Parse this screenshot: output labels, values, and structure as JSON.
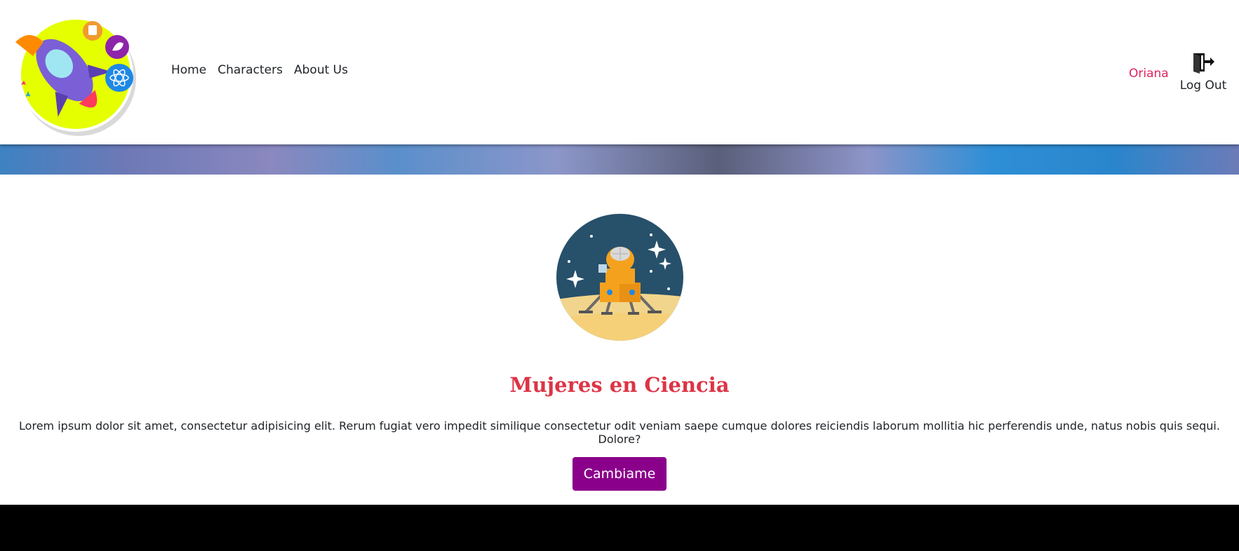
{
  "nav": {
    "items": [
      {
        "label": "Home"
      },
      {
        "label": "Characters"
      },
      {
        "label": "About Us"
      }
    ]
  },
  "user": {
    "name": "Oriana",
    "logout_label": "Log Out"
  },
  "hero": {
    "title": "Mujeres en Ciencia",
    "description": "Lorem ipsum dolor sit amet, consectetur adipisicing elit. Rerum fugiat vero impedit similique consectetur odit veniam saepe cumque dolores reiciendis laborum mollitia hic perferendis unde, natus nobis quis sequi. Dolore?",
    "button_label": "Cambiame"
  },
  "colors": {
    "title": "#dc3545",
    "button": "#8b008b",
    "user_name": "#e0245e",
    "footer": "#000000"
  },
  "icons": {
    "logo": "rocket-logo",
    "logout": "door-exit-icon",
    "hero": "lunar-lander-illustration"
  }
}
